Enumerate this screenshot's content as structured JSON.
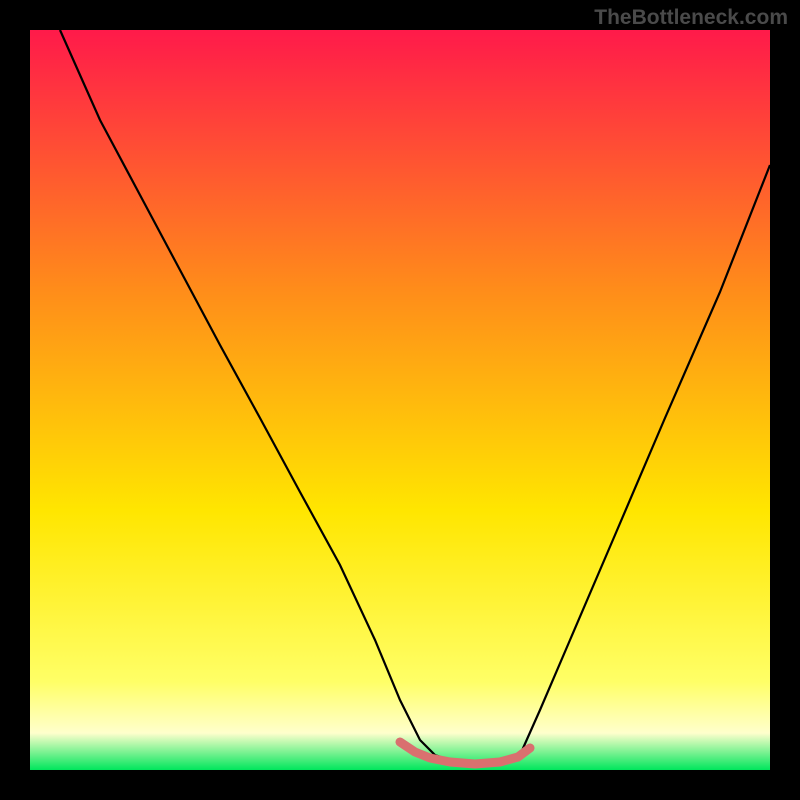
{
  "watermark": "TheBottleneck.com",
  "chart_data": {
    "type": "line",
    "title": "",
    "xlabel": "",
    "ylabel": "",
    "xlim": [
      0,
      100
    ],
    "ylim": [
      0,
      100
    ],
    "background_gradient": {
      "top": "#ff1a4a",
      "mid1": "#ff8c00",
      "mid2": "#ffff00",
      "bottom_band": "#ffff99",
      "base": "#00ff66"
    },
    "series": [
      {
        "name": "main-curve",
        "color": "#000000",
        "x": [
          4,
          10,
          15,
          20,
          25,
          30,
          35,
          40,
          45,
          48,
          50,
          52,
          55,
          58,
          62,
          65,
          68,
          72,
          78,
          85,
          92,
          99
        ],
        "y": [
          100,
          88,
          78,
          68,
          58,
          48,
          38,
          28,
          18,
          10,
          5,
          2,
          1,
          1,
          1,
          2,
          8,
          18,
          32,
          48,
          65,
          82
        ]
      },
      {
        "name": "bottom-highlight",
        "color": "#d9706f",
        "x": [
          48,
          50,
          52,
          55,
          58,
          62,
          65
        ],
        "y": [
          3,
          2,
          1.5,
          1,
          1,
          1.5,
          2.5
        ]
      }
    ]
  }
}
